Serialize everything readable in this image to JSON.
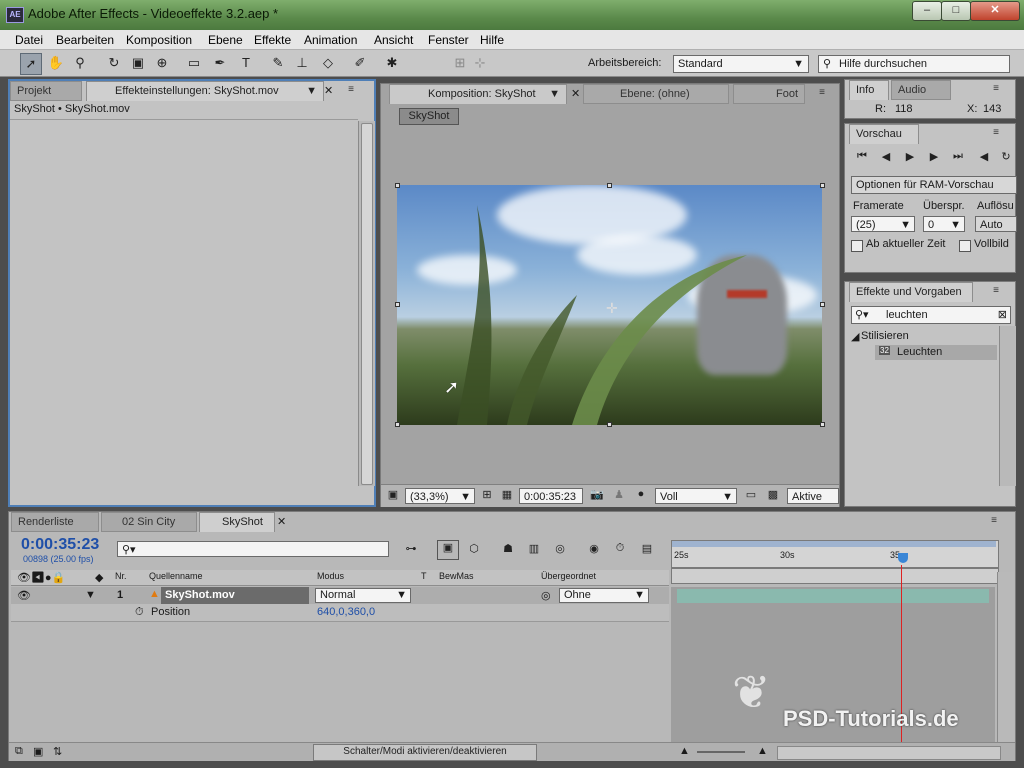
{
  "window": {
    "title": "Adobe After Effects - Videoeffekte 3.2.aep *",
    "app_icon": "AE"
  },
  "menu": [
    "Datei",
    "Bearbeiten",
    "Komposition",
    "Ebene",
    "Effekte",
    "Animation",
    "Ansicht",
    "Fenster",
    "Hilfe"
  ],
  "toolbar": {
    "workspace_label": "Arbeitsbereich:",
    "workspace_value": "Standard",
    "search_placeholder": "Hilfe durchsuchen"
  },
  "project_panel": {
    "tab_project": "Projekt",
    "tab_effects": "Effekteinstellungen: SkyShot.mov",
    "breadcrumb": "SkyShot • SkyShot.mov"
  },
  "comp_panel": {
    "tab_comp": "Komposition: SkyShot",
    "tab_layer": "Ebene: (ohne)",
    "tab_footage": "Foot",
    "comp_button": "SkyShot",
    "zoom": "(33,3%)",
    "timecode": "0:00:35:23",
    "resolution": "Voll",
    "active_camera": "Aktive Ka"
  },
  "info_panel": {
    "tab_info": "Info",
    "tab_audio": "Audio",
    "r_label": "R:",
    "r_value": "118",
    "x_label": "X:",
    "x_value": "143"
  },
  "preview_panel": {
    "title": "Vorschau",
    "ram_options": "Optionen für RAM-Vorschau",
    "framerate_label": "Framerate",
    "skip_label": "Überspr.",
    "res_label": "Auflösu",
    "framerate_value": "(25)",
    "skip_value": "0",
    "res_value": "Auto",
    "from_current": "Ab aktueller Zeit",
    "fullscreen": "Vollbild"
  },
  "effects_panel": {
    "title": "Effekte und Vorgaben",
    "search_value": "leuchten",
    "category": "Stilisieren",
    "item": "Leuchten"
  },
  "timeline": {
    "tabs": [
      "Renderliste",
      "02 Sin City",
      "SkyShot"
    ],
    "current_time": "0:00:35:23",
    "frame_info": "00898 (25.00 fps)",
    "columns": {
      "nr": "Nr.",
      "source": "Quellenname",
      "mode": "Modus",
      "t": "T",
      "trkmat": "BewMas",
      "parent": "Übergeordnet"
    },
    "layer": {
      "number": "1",
      "name": "SkyShot.mov",
      "mode": "Normal",
      "parent": "Ohne"
    },
    "property": {
      "name": "Position",
      "value": "640,0,360,0"
    },
    "ruler": [
      "25s",
      "30s",
      "35s"
    ],
    "toggle_label": "Schalter/Modi aktivieren/deaktivieren"
  },
  "watermark": "PSD-Tutorials.de"
}
